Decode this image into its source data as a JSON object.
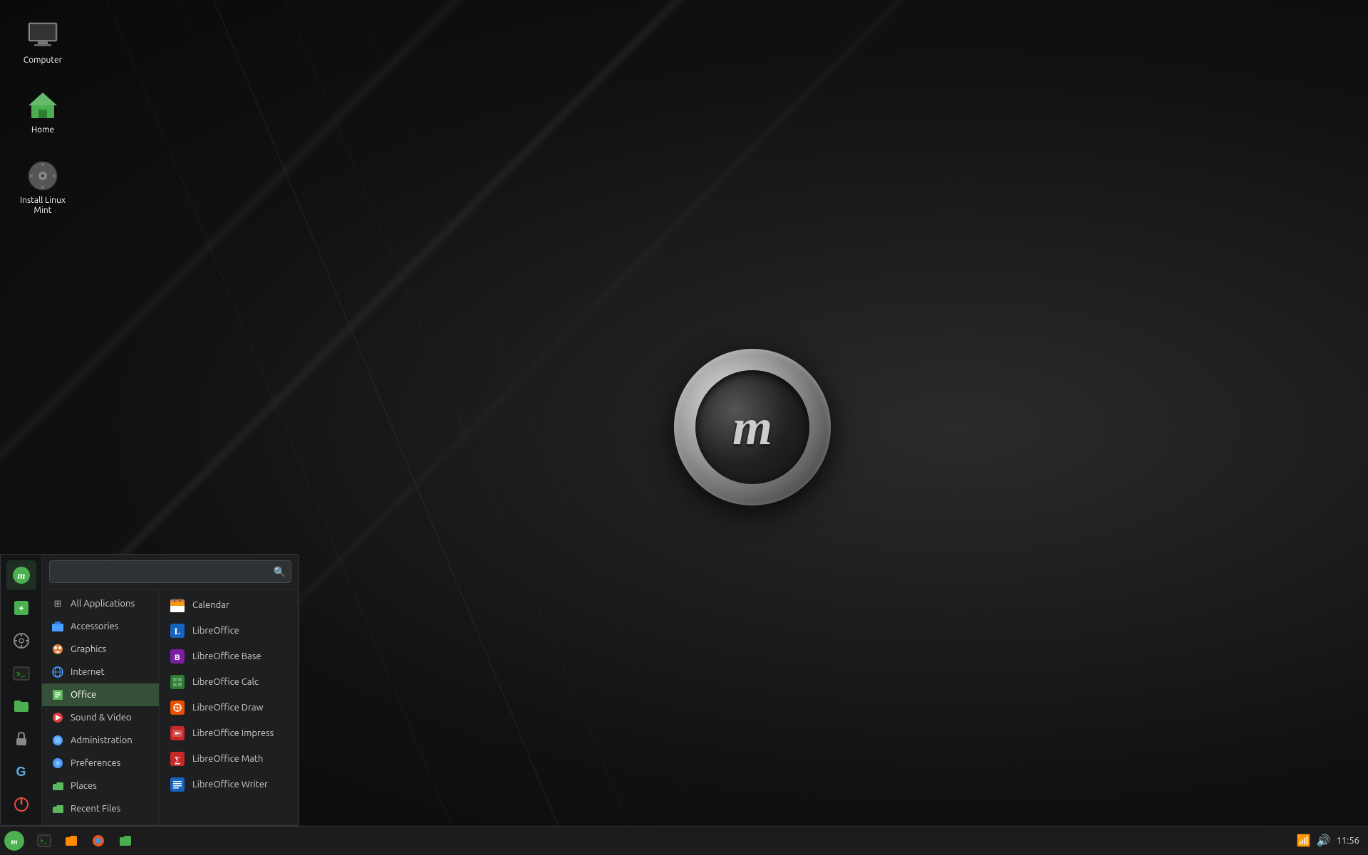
{
  "desktop": {
    "icons": [
      {
        "id": "computer",
        "label": "Computer",
        "icon": "🖥️"
      },
      {
        "id": "home",
        "label": "Home",
        "icon": "🏠"
      },
      {
        "id": "install-mint",
        "label": "Install Linux Mint",
        "icon": "💿"
      }
    ]
  },
  "taskbar": {
    "start_tooltip": "Menu",
    "items": [
      {
        "id": "terminal",
        "icon": "terminal",
        "label": ""
      },
      {
        "id": "files",
        "icon": "files",
        "label": ""
      },
      {
        "id": "firefox",
        "icon": "firefox",
        "label": ""
      },
      {
        "id": "folder",
        "icon": "folder",
        "label": ""
      }
    ],
    "tray": {
      "time": "11:56",
      "network_icon": "network",
      "volume_icon": "volume"
    }
  },
  "app_menu": {
    "search": {
      "placeholder": "",
      "value": ""
    },
    "sidebar_icons": [
      {
        "id": "mint",
        "icon": "🌿",
        "tooltip": "Linux Mint"
      },
      {
        "id": "software",
        "icon": "📦",
        "tooltip": "Software Manager"
      },
      {
        "id": "settings",
        "icon": "⚙️",
        "tooltip": "System Settings"
      },
      {
        "id": "terminal",
        "icon": ">_",
        "tooltip": "Terminal"
      },
      {
        "id": "folder",
        "icon": "📁",
        "tooltip": "Files"
      },
      {
        "id": "lock",
        "icon": "🔒",
        "tooltip": "Lock Screen"
      },
      {
        "id": "grub",
        "icon": "G",
        "tooltip": "Update Manager"
      },
      {
        "id": "power",
        "icon": "⏻",
        "tooltip": "Quit"
      }
    ],
    "categories": [
      {
        "id": "all",
        "label": "All Applications",
        "color": "#888",
        "icon": "⊞"
      },
      {
        "id": "accessories",
        "label": "Accessories",
        "color": "#4a9eff",
        "icon": "🔧"
      },
      {
        "id": "graphics",
        "label": "Graphics",
        "color": "#e07b39",
        "icon": "🎨"
      },
      {
        "id": "internet",
        "label": "Internet",
        "color": "#4a9eff",
        "icon": "🌐"
      },
      {
        "id": "office",
        "label": "Office",
        "color": "#5cb85c",
        "icon": "📄",
        "active": true
      },
      {
        "id": "sound-video",
        "label": "Sound & Video",
        "color": "#e03939",
        "icon": "🎵"
      },
      {
        "id": "administration",
        "label": "Administration",
        "color": "#4a9eff",
        "icon": "🔵"
      },
      {
        "id": "preferences",
        "label": "Preferences",
        "color": "#4a9eff",
        "icon": "🔵"
      },
      {
        "id": "places",
        "label": "Places",
        "color": "#5cb85c",
        "icon": "📁"
      },
      {
        "id": "recent",
        "label": "Recent Files",
        "color": "#5cb85c",
        "icon": "📁"
      }
    ],
    "apps": [
      {
        "id": "calendar",
        "label": "Calendar",
        "icon": "📅",
        "color": "#e07b39"
      },
      {
        "id": "libreoffice",
        "label": "LibreOffice",
        "icon": "L",
        "color": "#1e88e5"
      },
      {
        "id": "libreoffice-base",
        "label": "LibreOffice Base",
        "icon": "B",
        "color": "#9c27b0"
      },
      {
        "id": "libreoffice-calc",
        "label": "LibreOffice Calc",
        "icon": "C",
        "color": "#4caf50"
      },
      {
        "id": "libreoffice-draw",
        "label": "LibreOffice Draw",
        "icon": "D",
        "color": "#f39c12"
      },
      {
        "id": "libreoffice-impress",
        "label": "LibreOffice Impress",
        "icon": "I",
        "color": "#e74c3c"
      },
      {
        "id": "libreoffice-math",
        "label": "LibreOffice Math",
        "icon": "M",
        "color": "#e74c3c"
      },
      {
        "id": "libreoffice-writer",
        "label": "LibreOffice Writer",
        "icon": "W",
        "color": "#2196f3"
      }
    ]
  }
}
